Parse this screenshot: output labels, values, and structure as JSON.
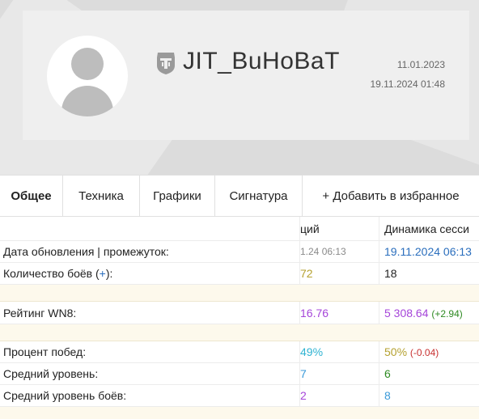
{
  "profile": {
    "nickname": "JIT_BuHoBaT",
    "created_date": "11.01.2023",
    "updated_datetime": "19.11.2024 01:48"
  },
  "tabs": [
    {
      "label": "Общее",
      "active": true
    },
    {
      "label": "Техника",
      "active": false
    },
    {
      "label": "Графики",
      "active": false
    },
    {
      "label": "Сигнатура",
      "active": false
    },
    {
      "label": "+ Добавить в избранное",
      "active": false
    }
  ],
  "table": {
    "col2_header": "ций",
    "col3_header": "Динамика сесси",
    "rows": [
      {
        "label": "Дата обновления | промежуток:",
        "v2": "1.24 06:13",
        "v3": "19.11.2024 06:13"
      },
      {
        "label_prefix": "Количество боёв (",
        "label_link": "+",
        "label_suffix": "):",
        "v2": "72",
        "v3": "18"
      },
      {
        "label": "Рейтинг WN8:",
        "v2": "16.76",
        "v3": "5 308.64",
        "v3_delta": "(+2.94)"
      },
      {
        "label": "Процент побед:",
        "v2": "49%",
        "v3": "50%",
        "v3_delta": "(-0.04)"
      },
      {
        "label": "Средний уровень:",
        "v2": "7",
        "v3": "6"
      },
      {
        "label": "Средний уровень боёв:",
        "v2": "2",
        "v3": "8"
      }
    ]
  },
  "icons": {
    "avatar": "user-silhouette-icon",
    "tank": "wot-tank-logo-icon"
  },
  "colors": {
    "link_blue": "#2a6ebd",
    "wn8_purple": "#a545d9",
    "winrate_cyan": "#2fb3d2",
    "winrate_olive": "#b5a130",
    "positive_green": "#2e8a22",
    "negative_red": "#c83030"
  }
}
